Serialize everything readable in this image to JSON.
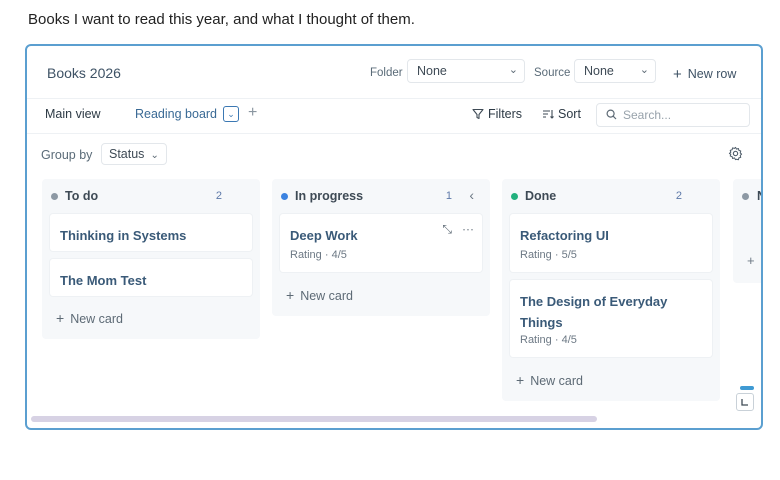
{
  "intro_text": "Books I want to read this year, and what I thought of them.",
  "database": {
    "title": "Books 2026",
    "folder_label": "Folder",
    "folder_value": "None",
    "source_label": "Source",
    "source_value": "None",
    "new_row_label": "New row"
  },
  "views": {
    "tabs": [
      {
        "label": "Main view",
        "active": false
      },
      {
        "label": "Reading board",
        "active": true
      }
    ],
    "add_view_icon": "plus-icon"
  },
  "toolbar": {
    "filters_label": "Filters",
    "sort_label": "Sort",
    "search_placeholder": "Search..."
  },
  "group_by": {
    "label": "Group by",
    "value": "Status"
  },
  "columns": [
    {
      "title": "To do",
      "count": "2",
      "dot_color": "#8d99a4",
      "cards": [
        {
          "title": "Thinking in Systems"
        },
        {
          "title": "The Mom Test"
        }
      ],
      "new_card_label": "New card"
    },
    {
      "title": "In progress",
      "count": "1",
      "dot_color": "#3b82e0",
      "cards": [
        {
          "title": "Deep Work",
          "subtitle": "Rating · 4/5"
        }
      ],
      "new_card_label": "New card"
    },
    {
      "title": "Done",
      "count": "2",
      "dot_color": "#22b07d",
      "cards": [
        {
          "title": "Refactoring UI",
          "subtitle": "Rating · 5/5"
        },
        {
          "title": "The Design of Everyday Things",
          "subtitle": "Rating · 4/5"
        }
      ],
      "new_card_label": "New card"
    },
    {
      "title": "N",
      "dot_color": "#8d99a4"
    }
  ],
  "colors": {
    "accent": "#3b78b3",
    "frame_border": "#5b9fd0"
  }
}
